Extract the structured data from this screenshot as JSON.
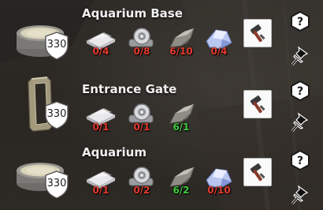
{
  "recipes": [
    {
      "name": "Aquarium Base",
      "level": "330",
      "thumb_icon": "aquarium-base-icon",
      "resources": [
        {
          "icon": "metal-plate-icon",
          "count": "0/4",
          "status": "red"
        },
        {
          "icon": "pipe-valve-icon",
          "count": "0/8",
          "status": "red"
        },
        {
          "icon": "stone-chunk-icon",
          "count": "6/10",
          "status": "red"
        },
        {
          "icon": "crystal-shard-icon",
          "count": "0/4",
          "status": "red"
        }
      ]
    },
    {
      "name": "Entrance Gate",
      "level": "330",
      "thumb_icon": "entrance-gate-icon",
      "resources": [
        {
          "icon": "metal-plate-icon",
          "count": "0/1",
          "status": "red"
        },
        {
          "icon": "pipe-valve-icon",
          "count": "0/1",
          "status": "red"
        },
        {
          "icon": "stone-chunk-icon",
          "count": "6/1",
          "status": "green"
        }
      ]
    },
    {
      "name": "Aquarium",
      "level": "330",
      "thumb_icon": "aquarium-icon",
      "resources": [
        {
          "icon": "metal-plate-icon",
          "count": "0/1",
          "status": "red"
        },
        {
          "icon": "pipe-valve-icon",
          "count": "0/2",
          "status": "red"
        },
        {
          "icon": "stone-chunk-icon",
          "count": "6/2",
          "status": "green"
        },
        {
          "icon": "crystal-shard-icon",
          "count": "0/10",
          "status": "red"
        }
      ]
    }
  ],
  "colors": {
    "insufficient": "#e53a2e",
    "sufficient": "#3ec93e",
    "title": "#f2f2f2",
    "craft_button_bg": "#fafafa"
  },
  "actions": {
    "craft_icon": "hammer-icon",
    "help_icon": "question-icon",
    "pin_icon": "pin-icon"
  }
}
